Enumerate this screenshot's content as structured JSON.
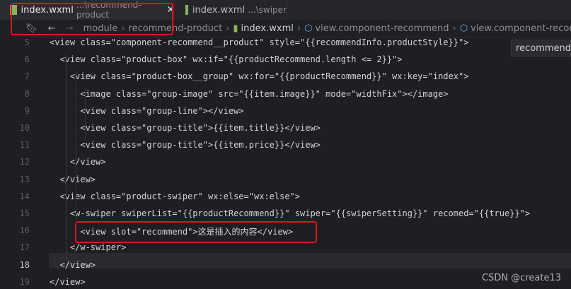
{
  "tabs": [
    {
      "name": "index.wxml",
      "path": "...\\recommend-product",
      "close": "✕"
    },
    {
      "name": "index.wxml",
      "path": "...\\swiper"
    }
  ],
  "breadcrumb": [
    "module",
    "recommend-product",
    "index.wxml",
    "view.component-recommend",
    "view.component-recommend"
  ],
  "side_hint": "recommend",
  "lines": [
    {
      "num": "5",
      "text": "<view class=\"component-recommend__product\" style=\"{{recommendInfo.productStyle}}\">"
    },
    {
      "num": "6",
      "text": "  <view class=\"product-box\" wx:if=\"{{productRecommend.length <= 2}}\">"
    },
    {
      "num": "7",
      "text": "    <view class=\"product-box__group\" wx:for=\"{{productRecommend}}\" wx:key=\"index\">"
    },
    {
      "num": "8",
      "text": "      <image class=\"group-image\" src=\"{{item.image}}\" mode=\"widthFix\"></image>"
    },
    {
      "num": "9",
      "text": "      <view class=\"group-line\"></view>"
    },
    {
      "num": "10",
      "text": "      <view class=\"group-title\">{{item.title}}</view>"
    },
    {
      "num": "11",
      "text": "      <view class=\"group-title\">{{item.price}}</view>"
    },
    {
      "num": "12",
      "text": "    </view>"
    },
    {
      "num": "13",
      "text": "  </view>"
    },
    {
      "num": "14",
      "text": "  <view class=\"product-swiper\" wx:else=\"wx:else\">"
    },
    {
      "num": "15",
      "text": "    <w-swiper swiperList=\"{{productRecommend}}\" swiper=\"{{swiperSetting}}\" recomed=\"{{true}}\">"
    },
    {
      "num": "16",
      "text": "      <view slot=\"recommend\">这是插入的内容</view>"
    },
    {
      "num": "17",
      "text": "    </w-swiper>"
    },
    {
      "num": "18",
      "text": "  </view>"
    },
    {
      "num": "19",
      "text": "</view>"
    }
  ],
  "watermark": "CSDN @create13",
  "colors": {
    "highlight_box": "#e0141e",
    "background": "#1e1f22",
    "string": "#ce9178",
    "tag": "#5fa4e8"
  }
}
